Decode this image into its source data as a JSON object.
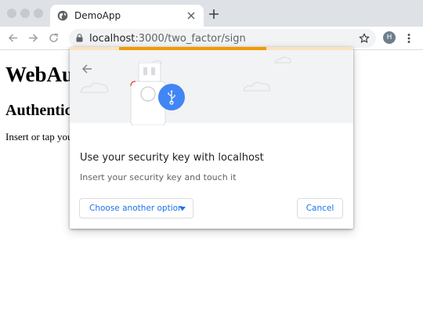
{
  "browser": {
    "tab": {
      "title": "DemoApp"
    },
    "url": {
      "host": "localhost",
      "path": ":3000/two_factor/sign"
    },
    "profile_initial": "H"
  },
  "page": {
    "heading": "WebAu",
    "subheading": "Authentic",
    "instruction": "Insert or tap you"
  },
  "dialog": {
    "progress": 0.52,
    "title": "Use your security key with localhost",
    "description": "Insert your security key and touch it",
    "choose_option_label": "Choose another option",
    "cancel_label": "Cancel"
  },
  "colors": {
    "accent": "#1a73e8",
    "progress": "#f29900",
    "key_icon": "#4285f4"
  },
  "icons": [
    "globe-icon",
    "close-icon",
    "plus-icon",
    "back-arrow-icon",
    "forward-arrow-icon",
    "reload-icon",
    "lock-icon",
    "star-icon",
    "menu-icon",
    "usb-icon",
    "chevron-down-icon"
  ]
}
